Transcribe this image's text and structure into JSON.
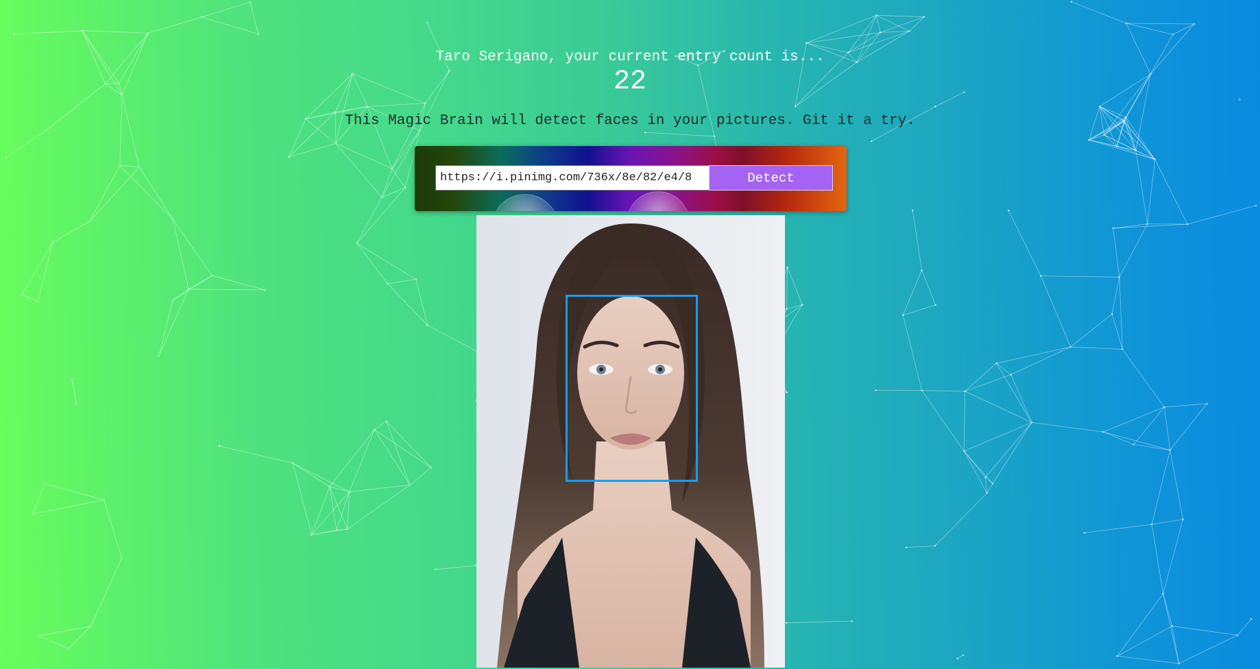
{
  "header": {
    "welcome_text": "Taro Serigano, your current entry count is...",
    "entry_count": "22"
  },
  "tagline": "This Magic Brain will detect faces in your pictures. Git it a try.",
  "form": {
    "url_value": "https://i.pinimg.com/736x/8e/82/e4/8",
    "detect_label": "Detect"
  },
  "result": {
    "image_description_icon": "portrait-photo",
    "face_box_color": "#149df2"
  },
  "colors": {
    "button": "#a463f2",
    "bg_start": "#68fd5c",
    "bg_end": "#0a8be0"
  }
}
